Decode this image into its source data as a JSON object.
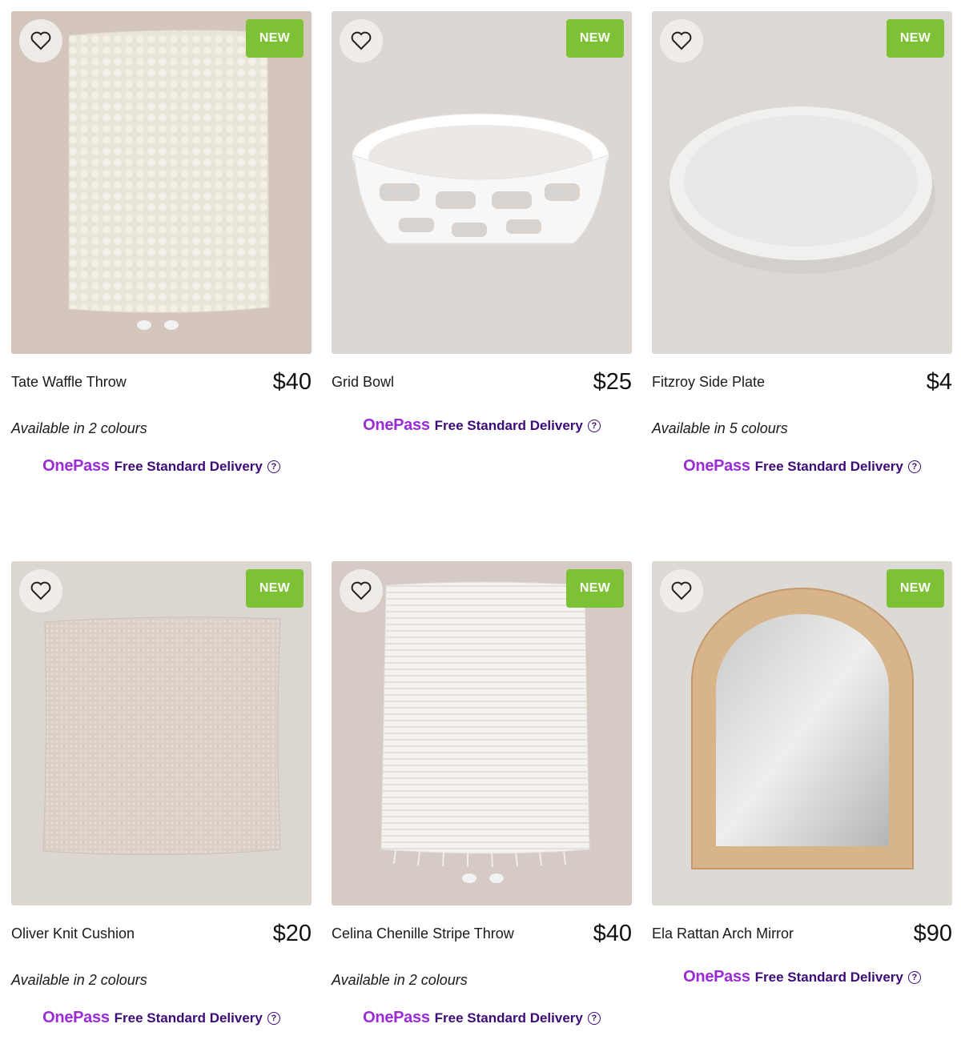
{
  "badge_label": "NEW",
  "delivery": {
    "brand": "OnePass",
    "label": "Free Standard Delivery",
    "help_glyph": "?"
  },
  "colors": {
    "badge": "#7dc234",
    "onepass_brand": "#9b2bd6",
    "delivery_text": "#3c0b78"
  },
  "products": [
    {
      "name": "Tate Waffle Throw",
      "price": "$40",
      "colours": "Available in 2 colours",
      "image": "waffle-throw-image"
    },
    {
      "name": "Grid Bowl",
      "price": "$25",
      "colours": "",
      "image": "grid-bowl-image"
    },
    {
      "name": "Fitzroy Side Plate",
      "price": "$4",
      "colours": "Available in 5 colours",
      "image": "side-plate-image"
    },
    {
      "name": "Oliver Knit Cushion",
      "price": "$20",
      "colours": "Available in 2 colours",
      "image": "knit-cushion-image"
    },
    {
      "name": "Celina Chenille Stripe Throw",
      "price": "$40",
      "colours": "Available in 2 colours",
      "image": "chenille-throw-image"
    },
    {
      "name": "Ela Rattan Arch Mirror",
      "price": "$90",
      "colours": "",
      "image": "arch-mirror-image"
    }
  ]
}
